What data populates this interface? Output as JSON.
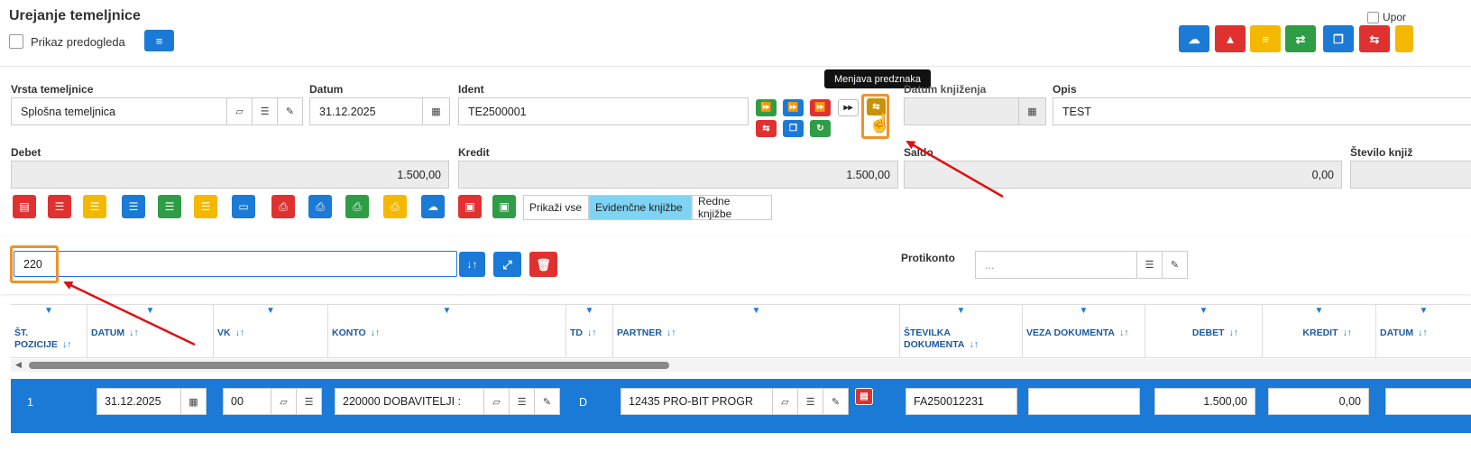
{
  "header": {
    "title": "Urejanje temeljnice",
    "preview_label": "Prikaz predogleda",
    "upor_label": "Upor"
  },
  "fields": {
    "vrsta_label": "Vrsta temeljnice",
    "vrsta_value": "Splošna temeljnica",
    "datum_label": "Datum",
    "datum_value": "31.12.2025",
    "ident_label": "Ident",
    "ident_value": "TE2500001",
    "datum_knjizenja_label": "Datum knjiženja",
    "opis_label": "Opis",
    "opis_value": "TEST",
    "debet_label": "Debet",
    "debet_value": "1.500,00",
    "kredit_label": "Kredit",
    "kredit_value": "1.500,00",
    "saldo_label": "Saldo",
    "saldo_value": "0,00",
    "stevilo_label": "Število knjiž"
  },
  "tooltip": "Menjava predznaka",
  "filters": {
    "prikazi_vse": "Prikaži vse",
    "evidencne": "Evidenčne knjižbe",
    "redne": "Redne knjižbe"
  },
  "search": {
    "value": "220",
    "protikonto_label": "Protikonto",
    "protikonto_placeholder": "..."
  },
  "table": {
    "columns": [
      "ŠT. POZICIJE",
      "DATUM",
      "VK",
      "KONTO",
      "TD",
      "PARTNER",
      "ŠTEVILKA DOKUMENTA",
      "VEZA DOKUMENTA",
      "DEBET",
      "KREDIT",
      "DATUM"
    ],
    "row": {
      "pozicija": "1",
      "datum": "31.12.2025",
      "vk": "00",
      "konto": "220000 DOBAVITELJI :",
      "td": "D",
      "partner": "12435 PRO-BIT PROGR",
      "stevilka": "FA250012231",
      "veza": "",
      "debet": "1.500,00",
      "kredit": "0,00"
    }
  },
  "colors": {
    "accent": "#1a7ad6",
    "highlight": "#f0922b",
    "row": "#1a7ad6",
    "annotation": "#e01010"
  }
}
